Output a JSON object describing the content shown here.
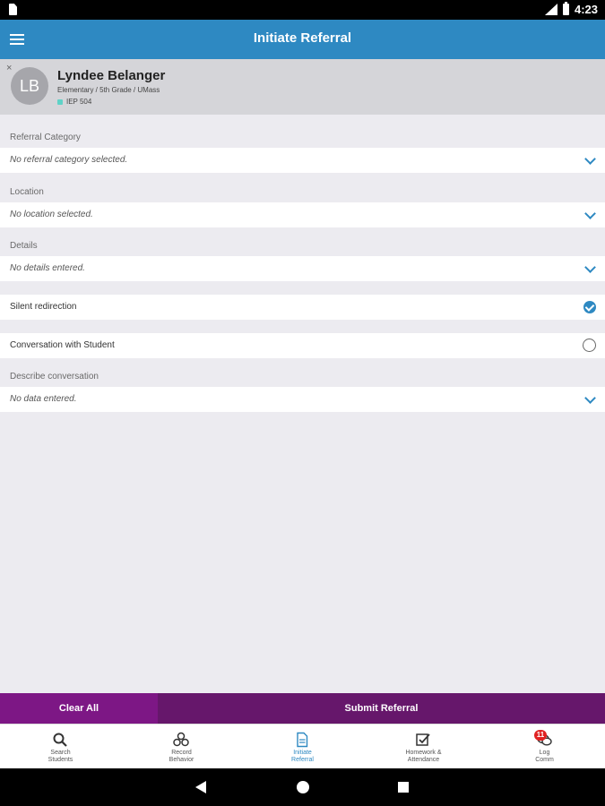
{
  "status_bar": {
    "time": "4:23"
  },
  "app_bar": {
    "title": "Initiate Referral"
  },
  "student": {
    "close": "×",
    "initials": "LB",
    "name": "Lyndee Belanger",
    "subtitle": "Elementary / 5th Grade / UMass",
    "tags": "IEP 504"
  },
  "form": {
    "referral_category": {
      "label": "Referral Category",
      "value": "No referral category selected."
    },
    "location": {
      "label": "Location",
      "value": "No location selected."
    },
    "details": {
      "label": "Details",
      "value": "No details entered."
    },
    "silent_redirection": {
      "label": "Silent redirection",
      "checked": true
    },
    "conversation": {
      "label": "Conversation with Student",
      "checked": false
    },
    "describe": {
      "label": "Describe conversation",
      "value": "No data entered."
    }
  },
  "actions": {
    "clear_label": "Clear All",
    "submit_label": "Submit Referral"
  },
  "bottom_nav": [
    {
      "label_line1": "Search",
      "label_line2": "Students",
      "icon": "search-icon"
    },
    {
      "label_line1": "Record",
      "label_line2": "Behavior",
      "icon": "behavior-icon"
    },
    {
      "label_line1": "Initiate",
      "label_line2": "Referral",
      "icon": "document-icon"
    },
    {
      "label_line1": "Homework &",
      "label_line2": "Attendance",
      "icon": "checkbox-icon"
    },
    {
      "label_line1": "Log",
      "label_line2": "Comm",
      "icon": "chat-icon",
      "badge": "11"
    }
  ],
  "colors": {
    "accent": "#2e89c2",
    "clear_button": "#7d1785",
    "submit_button": "#66176b",
    "badge": "#e02222"
  }
}
